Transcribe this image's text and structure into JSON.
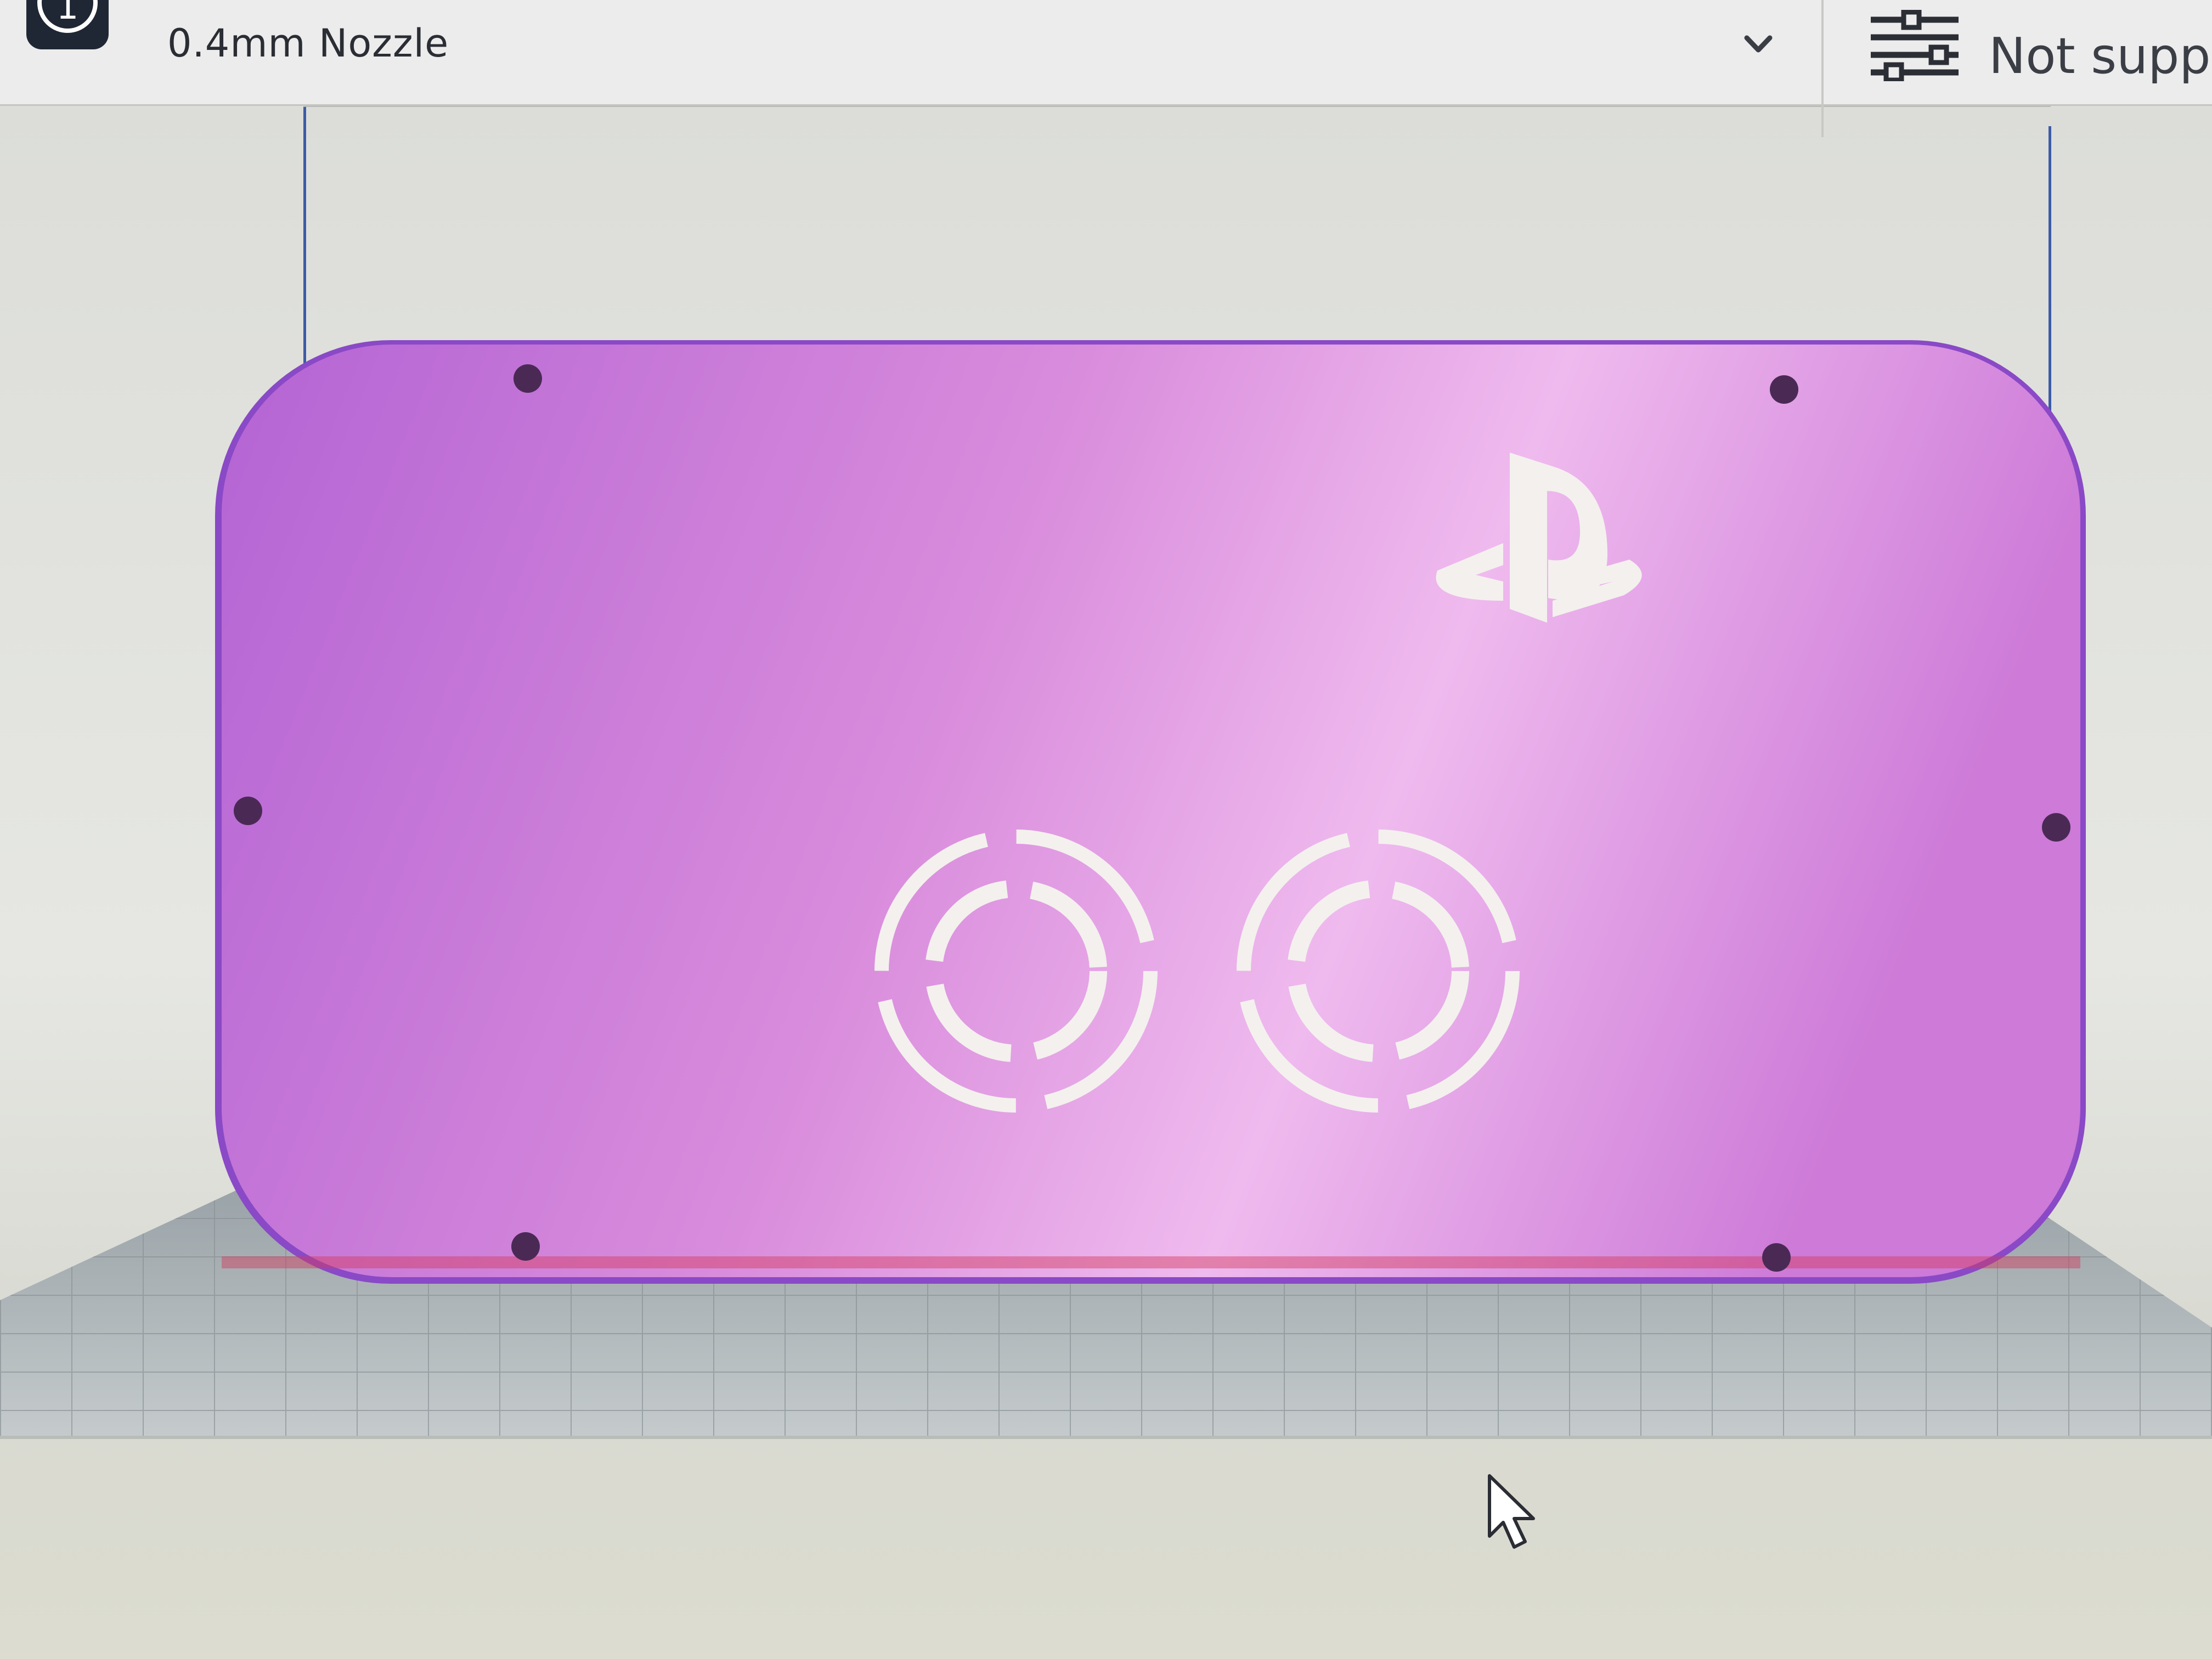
{
  "toolbar": {
    "extruder_number": "1",
    "nozzle_label": "0.4mm Nozzle",
    "support_label": "Not suppo"
  },
  "icons": {
    "extruder": "extruder-badge-icon",
    "dropdown": "chevron-down-icon",
    "settings": "sliders-icon",
    "cursor": "mouse-pointer-icon",
    "logo": "playstation-logo-icon"
  },
  "colors": {
    "model": "#c771d4",
    "model_light": "#eab5ea",
    "model_dark": "#8a49c6",
    "build_plate": "#c2c8ca",
    "volume_outline": "#3d5ca6",
    "toolbar_bg": "#ececec"
  }
}
